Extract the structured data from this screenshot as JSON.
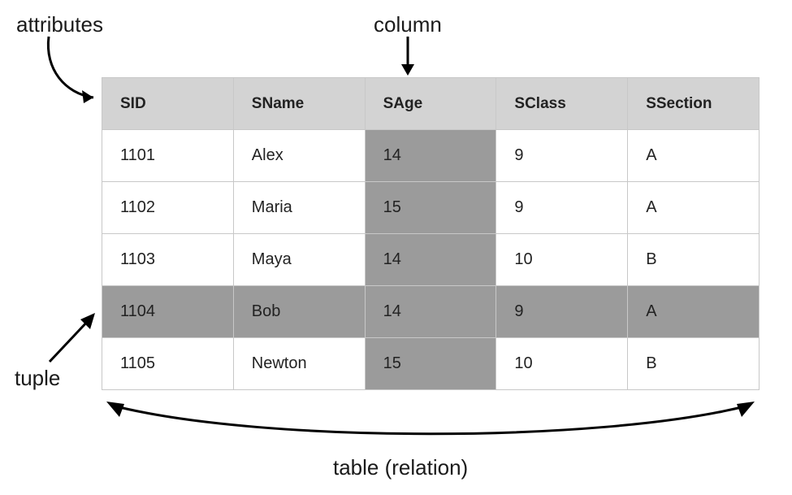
{
  "labels": {
    "attributes": "attributes",
    "column": "column",
    "tuple": "tuple",
    "relation": "table (relation)"
  },
  "table": {
    "headers": [
      "SID",
      "SName",
      "SAge",
      "SClass",
      "SSection"
    ],
    "rows": [
      {
        "sid": "1101",
        "sname": "Alex",
        "sage": "14",
        "sclass": "9",
        "ssection": "A"
      },
      {
        "sid": "1102",
        "sname": "Maria",
        "sage": "15",
        "sclass": "9",
        "ssection": "A"
      },
      {
        "sid": "1103",
        "sname": "Maya",
        "sage": "14",
        "sclass": "10",
        "ssection": "B"
      },
      {
        "sid": "1104",
        "sname": "Bob",
        "sage": "14",
        "sclass": "9",
        "ssection": "A"
      },
      {
        "sid": "1105",
        "sname": "Newton",
        "sage": "15",
        "sclass": "10",
        "ssection": "B"
      }
    ],
    "highlighted_column_index": 2,
    "highlighted_row_index": 3
  },
  "chart_data": {
    "type": "table",
    "title": "Relational database table with annotated parts",
    "annotations": {
      "attributes": "header row (SID, SName, SAge, SClass, SSection)",
      "column": "SAge column highlighted",
      "tuple": "row with SID 1104 highlighted",
      "relation": "entire table"
    },
    "columns": [
      "SID",
      "SName",
      "SAge",
      "SClass",
      "SSection"
    ],
    "rows": [
      [
        1101,
        "Alex",
        14,
        9,
        "A"
      ],
      [
        1102,
        "Maria",
        15,
        9,
        "A"
      ],
      [
        1103,
        "Maya",
        14,
        10,
        "B"
      ],
      [
        1104,
        "Bob",
        14,
        9,
        "A"
      ],
      [
        1105,
        "Newton",
        15,
        10,
        "B"
      ]
    ]
  }
}
